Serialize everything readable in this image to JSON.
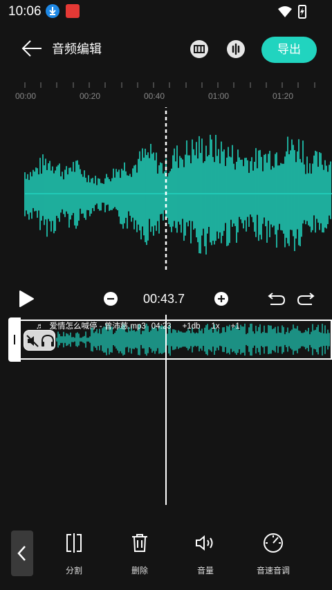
{
  "status": {
    "time": "10:06"
  },
  "header": {
    "title": "音频编辑",
    "export_label": "导出"
  },
  "ruler": {
    "ticks": [
      "00:00",
      "00:20",
      "00:40",
      "01:00",
      "01:20"
    ]
  },
  "controls": {
    "current_time": "00:43.7"
  },
  "track": {
    "filename": "爱情怎么喊停 - 曾沛慈.mp3",
    "duration": "04:23",
    "gain": "+1db",
    "speed": "1x",
    "pitch": "+1"
  },
  "toolbar": {
    "split_label": "分割",
    "delete_label": "删除",
    "volume_label": "音量",
    "speed_pitch_label": "音速音调"
  },
  "colors": {
    "accent": "#21d4bf",
    "background": "#141414"
  }
}
